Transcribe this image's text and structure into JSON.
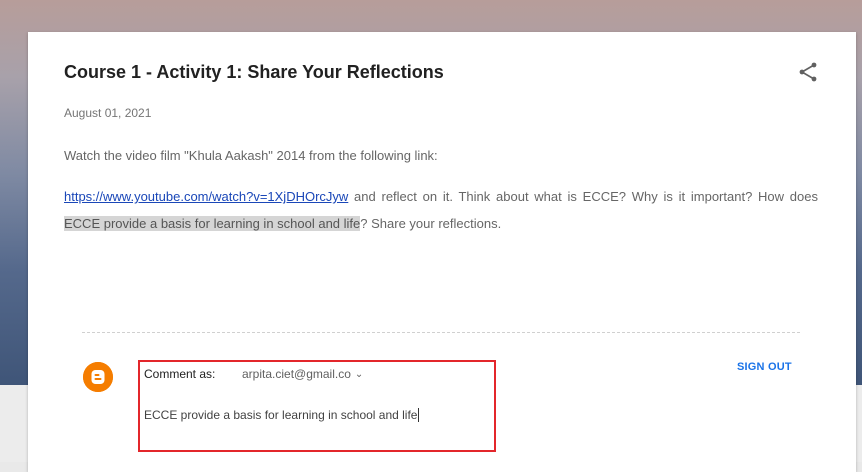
{
  "post": {
    "title": "Course 1 - Activity 1: Share Your Reflections",
    "date": "August 01, 2021",
    "paragraph1": "Watch the video film \"Khula Aakash\" 2014 from the following link:",
    "link": "https://www.youtube.com/watch?v=1XjDHOrcJyw",
    "paragraph2_after_link": " and reflect on it. Think about what is ECCE? Why is it important? How does ",
    "highlighted": "ECCE provide a basis for learning in school and life",
    "paragraph2_end": "? Share your reflections."
  },
  "comment": {
    "label": "Comment as:",
    "account": "arpita.ciet@gmail.co",
    "chevron": "⌄",
    "text": "ECCE provide a basis for learning in school and life",
    "sign_out": "SIGN OUT"
  },
  "icons": {
    "share": "share-icon",
    "blogger": "blogger-icon",
    "account_dropdown": "chevron-down-icon"
  },
  "colors": {
    "blogger_orange": "#f57d00",
    "link_blue": "#1a47b8",
    "signout_blue": "#1a73e8",
    "highlight_border": "#e3262b"
  }
}
